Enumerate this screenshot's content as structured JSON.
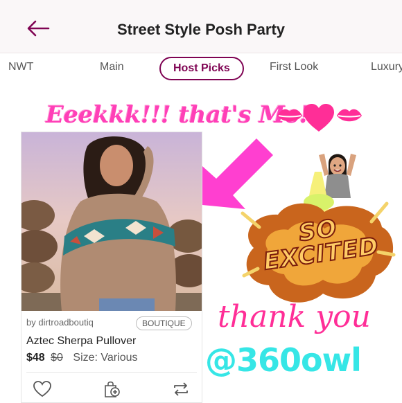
{
  "header": {
    "title": "Street Style Posh Party",
    "back_icon": "arrow-left-icon",
    "accent": "#7f0353"
  },
  "tabs": [
    {
      "label": "NWT"
    },
    {
      "label": "Main"
    },
    {
      "label": "Host Picks",
      "active": true
    },
    {
      "label": "First Look"
    },
    {
      "label": "Luxury"
    }
  ],
  "overlay": {
    "headline": "Eeekkk!!! that's Me!",
    "excited": "SO EXCITED",
    "thanks": "thank you",
    "handle": "@360owl",
    "colors": {
      "pink": "#ff3fb7",
      "cyan": "#36e6e6"
    }
  },
  "listing": {
    "seller": "by dirtroadboutiq",
    "badge": "BOUTIQUE",
    "title": "Aztec Sherpa Pullover",
    "price": "$48",
    "original_price": "$0",
    "size": "Size: Various",
    "actions": [
      "heart-icon",
      "add-to-bundle-icon",
      "share-icon"
    ]
  }
}
